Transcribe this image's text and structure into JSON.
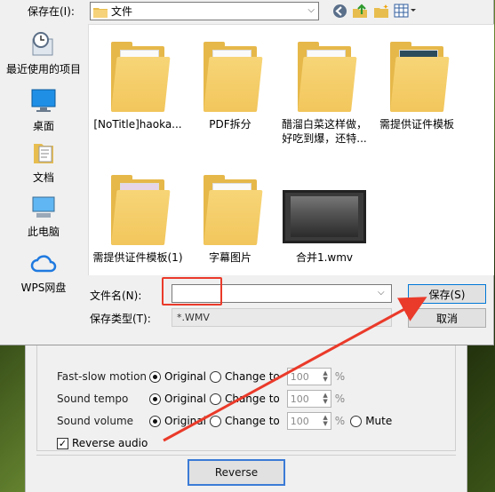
{
  "dialog": {
    "save_in_label": "保存在(I):",
    "current_folder": "文件",
    "places": [
      {
        "label": "最近使用的项目",
        "icon": "recent-items-icon"
      },
      {
        "label": "桌面",
        "icon": "desktop-icon"
      },
      {
        "label": "文档",
        "icon": "documents-icon"
      },
      {
        "label": "此电脑",
        "icon": "this-pc-icon"
      },
      {
        "label": "WPS网盘",
        "icon": "cloud-icon"
      }
    ],
    "files": [
      {
        "name": "[NoTitle]haoka...",
        "type": "folder"
      },
      {
        "name": "PDF拆分",
        "type": "folder"
      },
      {
        "name": "醋溜白菜这样做，好吃到爆，还特...",
        "type": "folder"
      },
      {
        "name": "需提供证件模板",
        "type": "folder"
      },
      {
        "name": "需提供证件模板(1)",
        "type": "folder"
      },
      {
        "name": "字幕图片",
        "type": "folder"
      },
      {
        "name": "合并1.wmv",
        "type": "video"
      }
    ],
    "file_name_label": "文件名(N):",
    "file_name_value": "",
    "file_type_label": "保存类型(T):",
    "file_type_value": "*.WMV",
    "save_button": "保存(S)",
    "cancel_button": "取消"
  },
  "background_app": {
    "options": [
      {
        "label": "Fast-slow motion",
        "original": "Original",
        "change_to": "Change to",
        "value": "100",
        "unit": "%"
      },
      {
        "label": "Sound tempo",
        "original": "Original",
        "change_to": "Change to",
        "value": "100",
        "unit": "%"
      },
      {
        "label": "Sound volume",
        "original": "Original",
        "change_to": "Change to",
        "value": "100",
        "unit": "%",
        "mute": "Mute"
      }
    ],
    "reverse_audio_label": "Reverse audio",
    "reverse_audio_checked": true,
    "reverse_button": "Reverse"
  },
  "colors": {
    "annotation": "#ea3a2a",
    "folder": "#f2c65c",
    "accent": "#0078d7"
  }
}
